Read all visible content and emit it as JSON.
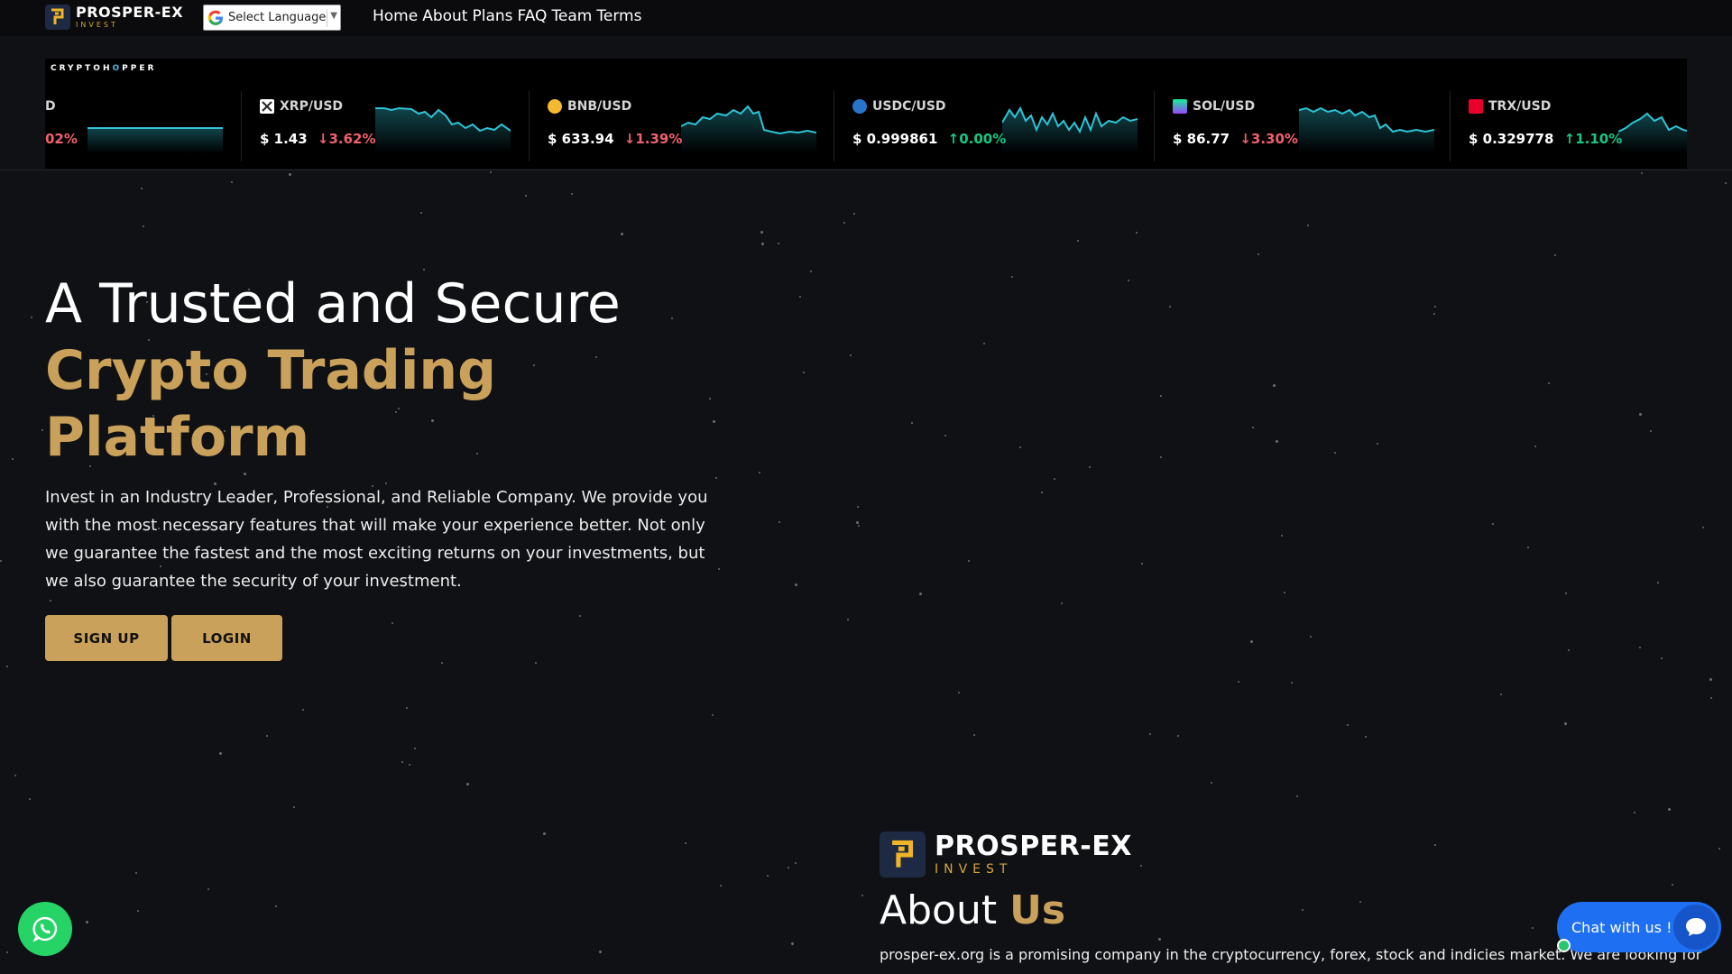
{
  "brand": {
    "name": "PROSPER-EX",
    "tagline": "INVEST",
    "accent_color": "#c9a15a",
    "logo_icon": "p-logo-icon"
  },
  "language": {
    "label": "Select Language",
    "icon": "google-icon"
  },
  "nav": {
    "items": [
      "Home",
      "About",
      "Plans",
      "FAQ",
      "Team",
      "Terms"
    ]
  },
  "ticker": {
    "brand_prefix": "CRYPTOH",
    "brand_o": "O",
    "brand_suffix": "PPER",
    "items": [
      {
        "name": "D",
        "price": "",
        "change": "02%",
        "direction": "down",
        "icon": ""
      },
      {
        "name": "XRP/USD",
        "price": "$ 1.43",
        "change": "3.62%",
        "direction": "down",
        "icon": "xrp-icon"
      },
      {
        "name": "BNB/USD",
        "price": "$ 633.94",
        "change": "1.39%",
        "direction": "down",
        "icon": "bnb-icon"
      },
      {
        "name": "USDC/USD",
        "price": "$ 0.999861",
        "change": "0.00%",
        "direction": "up",
        "icon": "usdc-icon"
      },
      {
        "name": "SOL/USD",
        "price": "$ 86.77",
        "change": "3.30%",
        "direction": "down",
        "icon": "sol-icon"
      },
      {
        "name": "TRX/USD",
        "price": "$ 0.329778",
        "change": "1.10%",
        "direction": "up",
        "icon": "trx-icon"
      }
    ]
  },
  "hero": {
    "title_line1": "A Trusted and Secure",
    "title_line2": "Crypto Trading Platform",
    "description": "Invest in an Industry Leader, Professional, and Reliable Company. We provide you with the most necessary features that will make your experience better. Not only we guarantee the fastest and the most exciting returns on your investments, but we also guarantee the security of your investment.",
    "signup_label": "SIGN UP",
    "login_label": "LOGIN"
  },
  "about": {
    "title_plain": "About",
    "title_accent": "Us",
    "text": "prosper-ex.org is a promising company in the cryptocurrency, forex, stock and indicies market. We are looking for"
  },
  "widgets": {
    "whatsapp_icon": "whatsapp-icon",
    "chat_label": "Chat with us !!",
    "chat_icon": "chat-bubble-icon"
  }
}
